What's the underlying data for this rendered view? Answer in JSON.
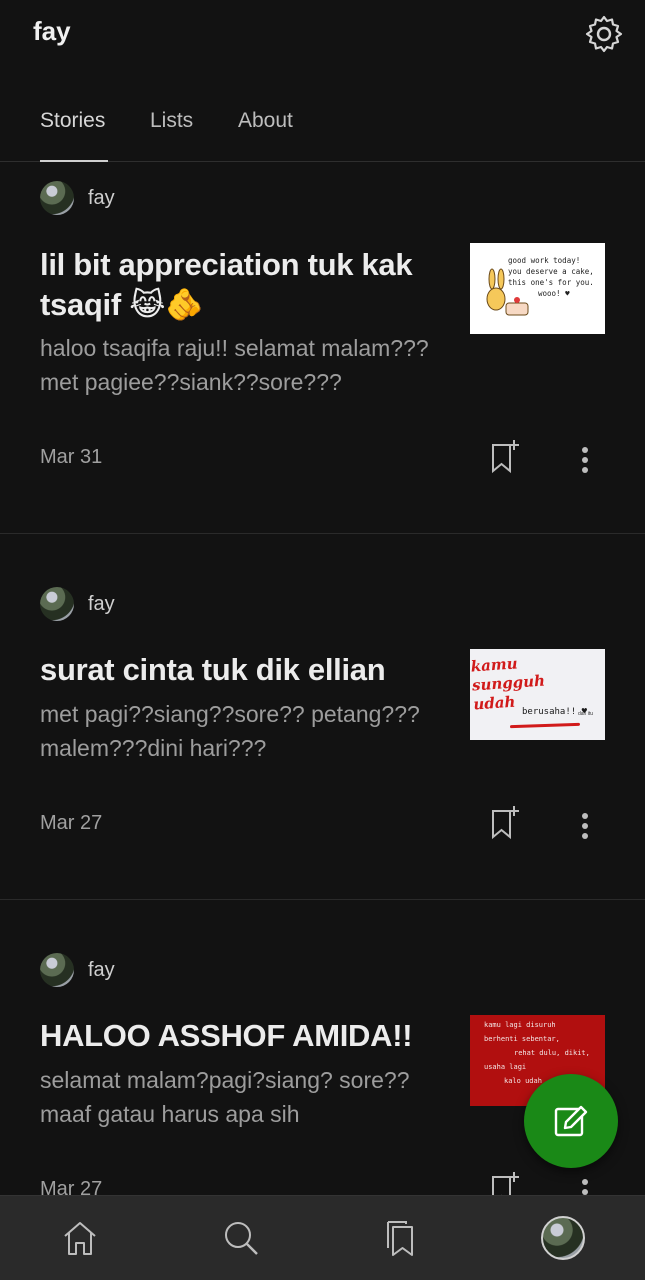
{
  "header": {
    "title": "fay",
    "settings_icon": "gear-icon"
  },
  "tabs": [
    {
      "label": "Stories",
      "active": true
    },
    {
      "label": "Lists",
      "active": false
    },
    {
      "label": "About",
      "active": false
    }
  ],
  "stories": [
    {
      "author": "fay",
      "title": "lil bit appreciation tuk kak tsaqif 😹🫵",
      "excerpt": "haloo tsaqifa raju!! selamat malam???met pagiee??siank??sore???",
      "date": "Mar 31",
      "thumb_text": [
        "good work today!",
        "you deserve a cake,",
        "this one's for you.",
        "wooo! ♥"
      ]
    },
    {
      "author": "fay",
      "title": "surat cinta tuk dik ellian",
      "excerpt": "met pagi??siang??sore?? petang???malem???dini hari???",
      "date": "Mar 27",
      "thumb_text": [
        "kamu",
        "sungguh",
        "udah",
        "berusaha!! ♥",
        "dan itu"
      ]
    },
    {
      "author": "fay",
      "title": "HALOO ASSHOF AMIDA!!",
      "excerpt": "selamat malam?pagi?siang? sore?? maaf gatau harus apa sih",
      "date": "Mar 27",
      "thumb_text": [
        "kamu lagi disuruh",
        "berhenti sebentar,",
        "rehat dulu, dikit,",
        "usaha lagi",
        "kalo udah"
      ]
    }
  ],
  "colors": {
    "background": "#121212",
    "accent": "#1a8917",
    "nav": "#2a2a2a"
  },
  "bottom_nav": [
    "home-icon",
    "search-icon",
    "library-icon",
    "profile-avatar"
  ]
}
